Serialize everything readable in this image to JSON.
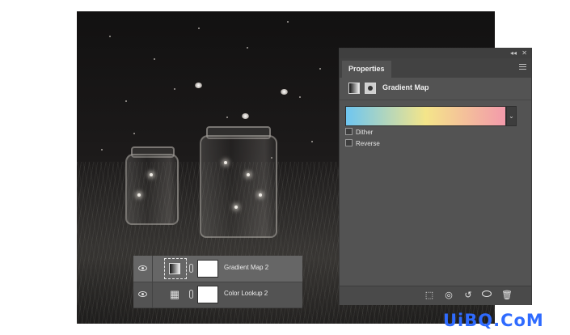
{
  "properties_panel": {
    "collapse_glyph": "◂◂",
    "close_glyph": "✕",
    "tab_label": "Properties",
    "adjustment_title": "Gradient Map",
    "gradient": {
      "stops": [
        "#6ec6f1",
        "#f4e58a",
        "#f39aab"
      ]
    },
    "dropdown_glyph": "⌄",
    "dither_label": "Dither",
    "dither_checked": false,
    "reverse_label": "Reverse",
    "reverse_checked": false,
    "footer_icons": [
      "clip-to-layer-icon",
      "view-previous-state-icon",
      "reset-icon",
      "visibility-icon",
      "trash-icon"
    ]
  },
  "layers": [
    {
      "name": "Gradient Map 2",
      "type": "gradient-map",
      "visible": true,
      "selected": true
    },
    {
      "name": "Color Lookup 2",
      "type": "color-lookup",
      "visible": true,
      "selected": false
    }
  ],
  "watermark": "UiBQ.CoM",
  "colors": {
    "panel_bg": "#535353",
    "selected_row": "#666666",
    "watermark": "#2f6bff"
  }
}
